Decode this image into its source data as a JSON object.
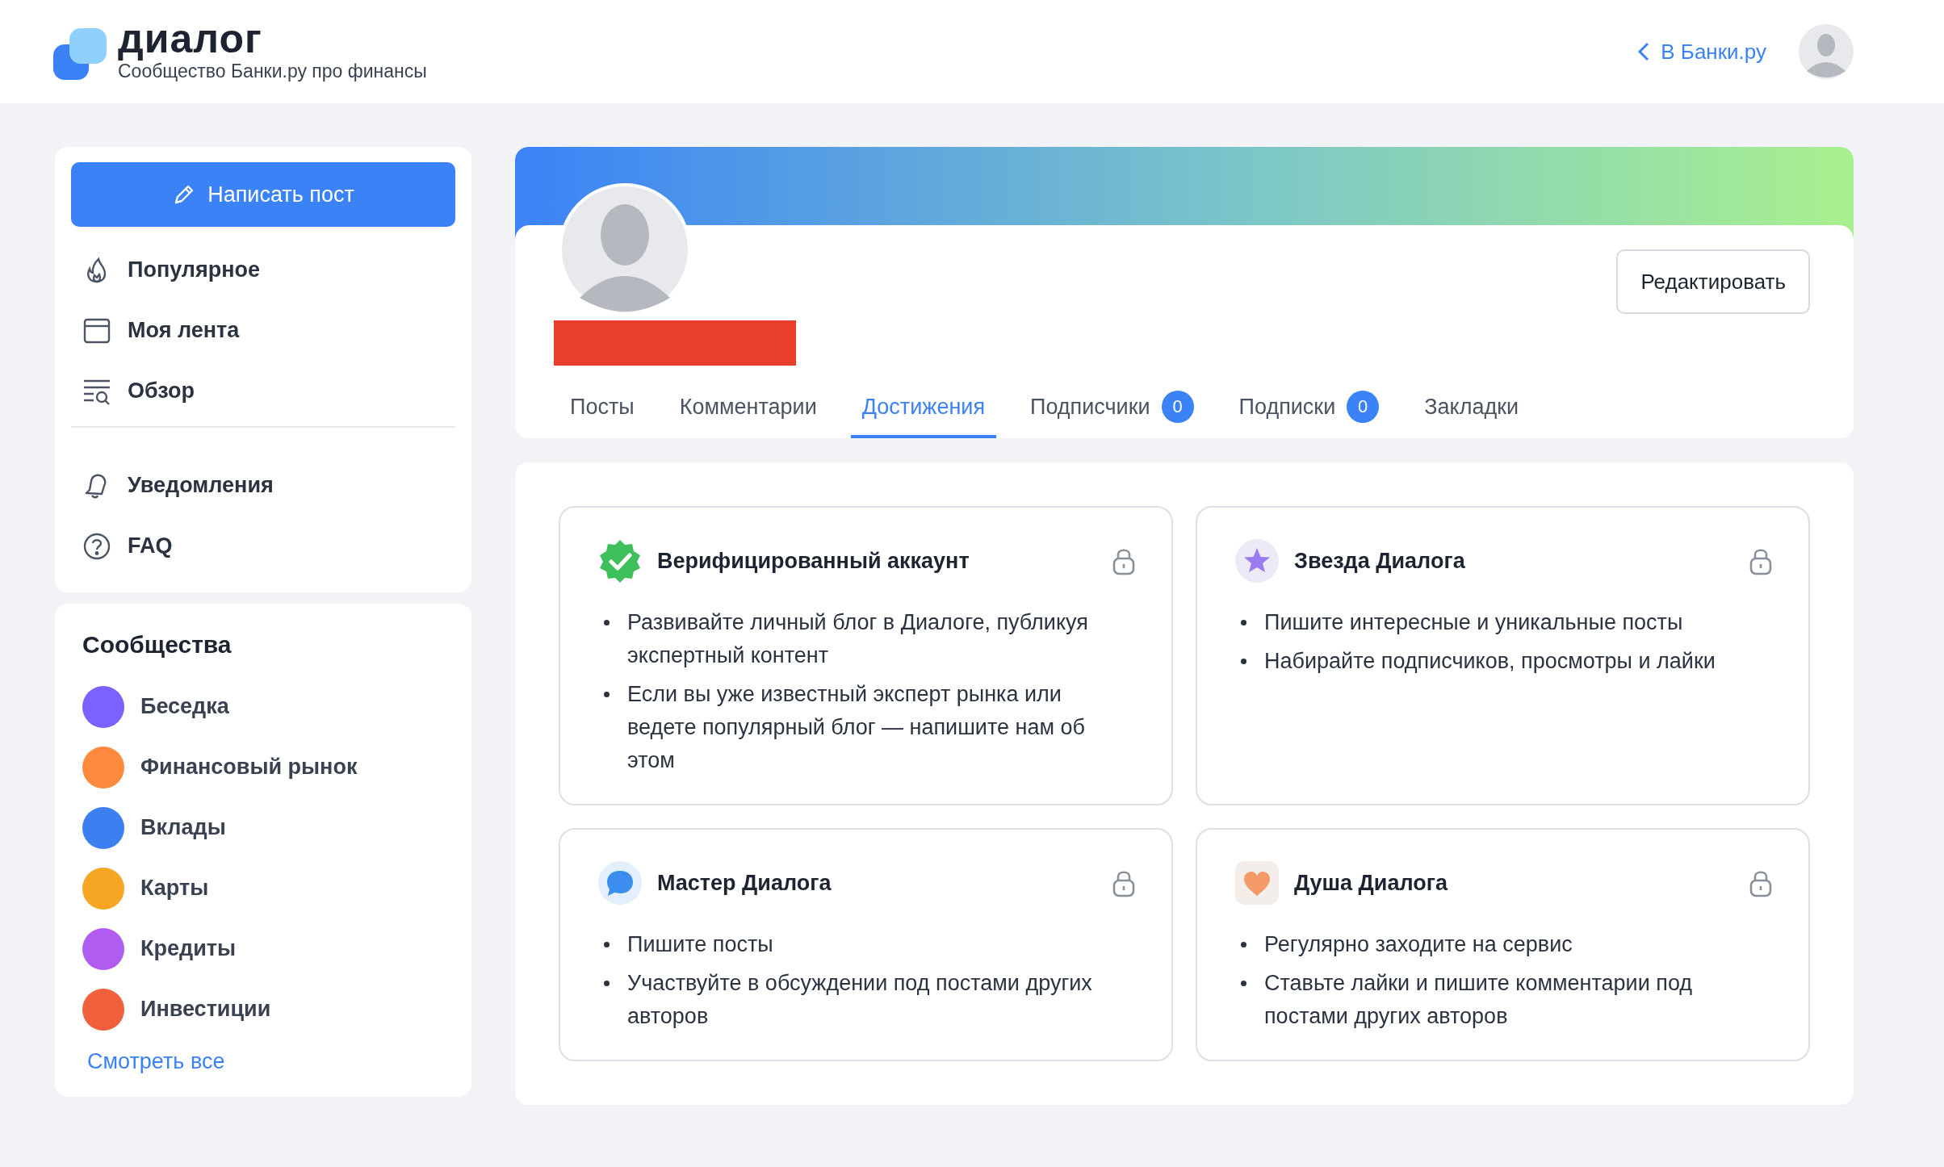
{
  "header": {
    "logo_title": "диалог",
    "logo_subtitle": "Сообщество Банки.ру про финансы",
    "back_link": "В Банки.ру"
  },
  "sidebar": {
    "write_button": "Написать пост",
    "nav": [
      {
        "kind": "popular",
        "label": "Популярное"
      },
      {
        "kind": "feed",
        "label": "Моя лента"
      },
      {
        "kind": "overview",
        "label": "Обзор"
      }
    ],
    "nav2": [
      {
        "kind": "bell",
        "label": "Уведомления"
      },
      {
        "kind": "faq",
        "label": "FAQ"
      }
    ],
    "communities_title": "Сообщества",
    "communities": [
      {
        "label": "Беседка",
        "color": "#7b61ff"
      },
      {
        "label": "Финансовый рынок",
        "color": "#ff8a3d"
      },
      {
        "label": "Вклады",
        "color": "#3b7ff0"
      },
      {
        "label": "Карты",
        "color": "#f5a623"
      },
      {
        "label": "Кредиты",
        "color": "#b05cf0"
      },
      {
        "label": "Инвестиции",
        "color": "#f0603b"
      }
    ],
    "see_all": "Смотреть все"
  },
  "profile": {
    "edit_button": "Редактировать",
    "tabs": [
      {
        "label": "Посты",
        "selected": false
      },
      {
        "label": "Комментарии",
        "selected": false
      },
      {
        "label": "Достижения",
        "selected": true
      },
      {
        "label": "Подписчики",
        "selected": false,
        "count": "0"
      },
      {
        "label": "Подписки",
        "selected": false,
        "count": "0"
      },
      {
        "label": "Закладки",
        "selected": false
      }
    ]
  },
  "achievements": [
    {
      "kind": "verified",
      "title": "Верифицированный аккаунт",
      "locked": true,
      "bullets": [
        "Развивайте личный блог в Диалоге, публикуя экспертный контент",
        "Если вы уже известный эксперт рынка или ведете популярный блог — напишите нам об этом"
      ]
    },
    {
      "kind": "star",
      "title": "Звезда Диалога",
      "locked": true,
      "bullets": [
        "Пишите интересные и уникальные посты",
        "Набирайте подписчиков, просмотры и лайки"
      ]
    },
    {
      "kind": "chat",
      "title": "Мастер Диалога",
      "locked": true,
      "bullets": [
        "Пишите посты",
        "Участвуйте в обсуждении под постами других авторов"
      ]
    },
    {
      "kind": "heart",
      "title": "Душа Диалога",
      "locked": true,
      "bullets": [
        "Регулярно заходите на сервис",
        "Ставьте лайки и пишите комментарии под постами других авторов"
      ]
    }
  ]
}
